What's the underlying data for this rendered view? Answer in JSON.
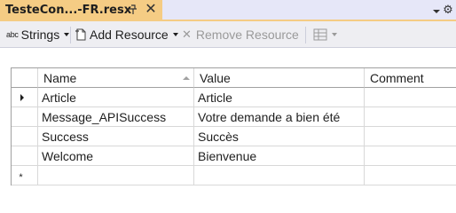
{
  "tab": {
    "title": "TesteCon...-FR.resx",
    "pin_icon": "pin-icon",
    "close_icon": "close-icon",
    "close_glyph": "✕"
  },
  "toolbar": {
    "strings_label": "Strings",
    "strings_icon_text": "abc",
    "add_resource_label": "Add Resource",
    "remove_resource_label": "Remove Resource",
    "remove_glyph": "✕",
    "grid_view_icon": "grid-view-icon"
  },
  "grid": {
    "columns": [
      "Name",
      "Value",
      "Comment"
    ],
    "rows": [
      {
        "name": "Article",
        "value": "Article",
        "comment": "",
        "current": true
      },
      {
        "name": "Message_APISuccess",
        "value": "Votre demande a bien été",
        "comment": ""
      },
      {
        "name": "Success",
        "value": "Succès",
        "comment": ""
      },
      {
        "name": "Welcome",
        "value": "Bienvenue",
        "comment": ""
      }
    ],
    "new_row_marker": "*"
  },
  "colors": {
    "tab_active": "#f5cc84",
    "tabstrip_bg": "#e6e7f8",
    "toolbar_bg": "#eeeef2",
    "disabled_text": "#9a9a9a"
  }
}
